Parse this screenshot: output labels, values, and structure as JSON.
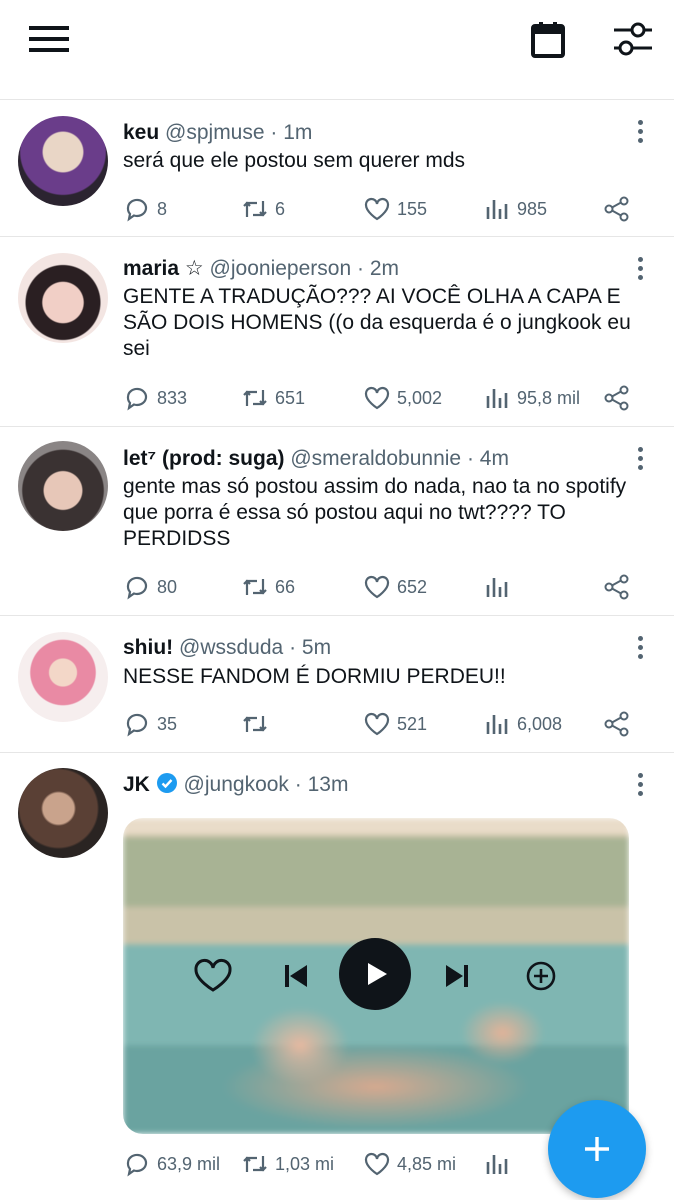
{
  "icons": {
    "menu": "hamburger-menu-icon",
    "calendar": "calendar-icon",
    "filter": "sliders-icon",
    "reply": "reply-icon",
    "retweet": "retweet-icon",
    "like": "heart-icon",
    "views": "views-icon",
    "share": "share-icon",
    "more": "more-vertical-icon",
    "compose": "plus-icon"
  },
  "colors": {
    "accent": "#1d9bf0",
    "text": "#0f1419",
    "secondary": "#536471",
    "divider": "#e6e6e6"
  },
  "tweets": [
    {
      "name": "keu",
      "handle": "@spjmuse",
      "time": "1m",
      "text": "será que ele postou sem querer mds",
      "replies": "8",
      "retweets": "6",
      "likes": "155",
      "views": "985"
    },
    {
      "name": "maria ☆",
      "handle": "@joonieperson",
      "time": "2m",
      "text": "GENTE A TRADUÇÃO??? AI VOCÊ OLHA A CAPA E SÃO DOIS HOMENS ((o da esquerda é o jungkook eu sei",
      "replies": "833",
      "retweets": "651",
      "likes": "5,002",
      "views": "95,8 mil"
    },
    {
      "name": "let⁷ (prod: suga)",
      "handle": "@smeraldobunnie",
      "time": "4m",
      "text": "gente mas só postou assim do nada, nao ta no spotify que porra é essa só postou aqui no twt???? TO PERDIDSS",
      "replies": "80",
      "retweets": "66",
      "likes": "652",
      "views": ""
    },
    {
      "name": "shiu!",
      "handle": "@wssduda",
      "time": "5m",
      "text": "NESSE FANDOM É DORMIU PERDEU!!",
      "replies": "35",
      "retweets": "",
      "likes": "521",
      "views": "6,008"
    },
    {
      "name": "JK",
      "verified": true,
      "handle": "@jungkook",
      "time": "13m",
      "text": "",
      "media": {
        "type": "audio-player",
        "controls": [
          "heart-icon",
          "previous-icon",
          "play-icon",
          "next-icon",
          "add-circle-icon"
        ]
      },
      "replies": "63,9 mil",
      "retweets": "1,03 mi",
      "likes": "4,85 mi",
      "views": ""
    }
  ]
}
